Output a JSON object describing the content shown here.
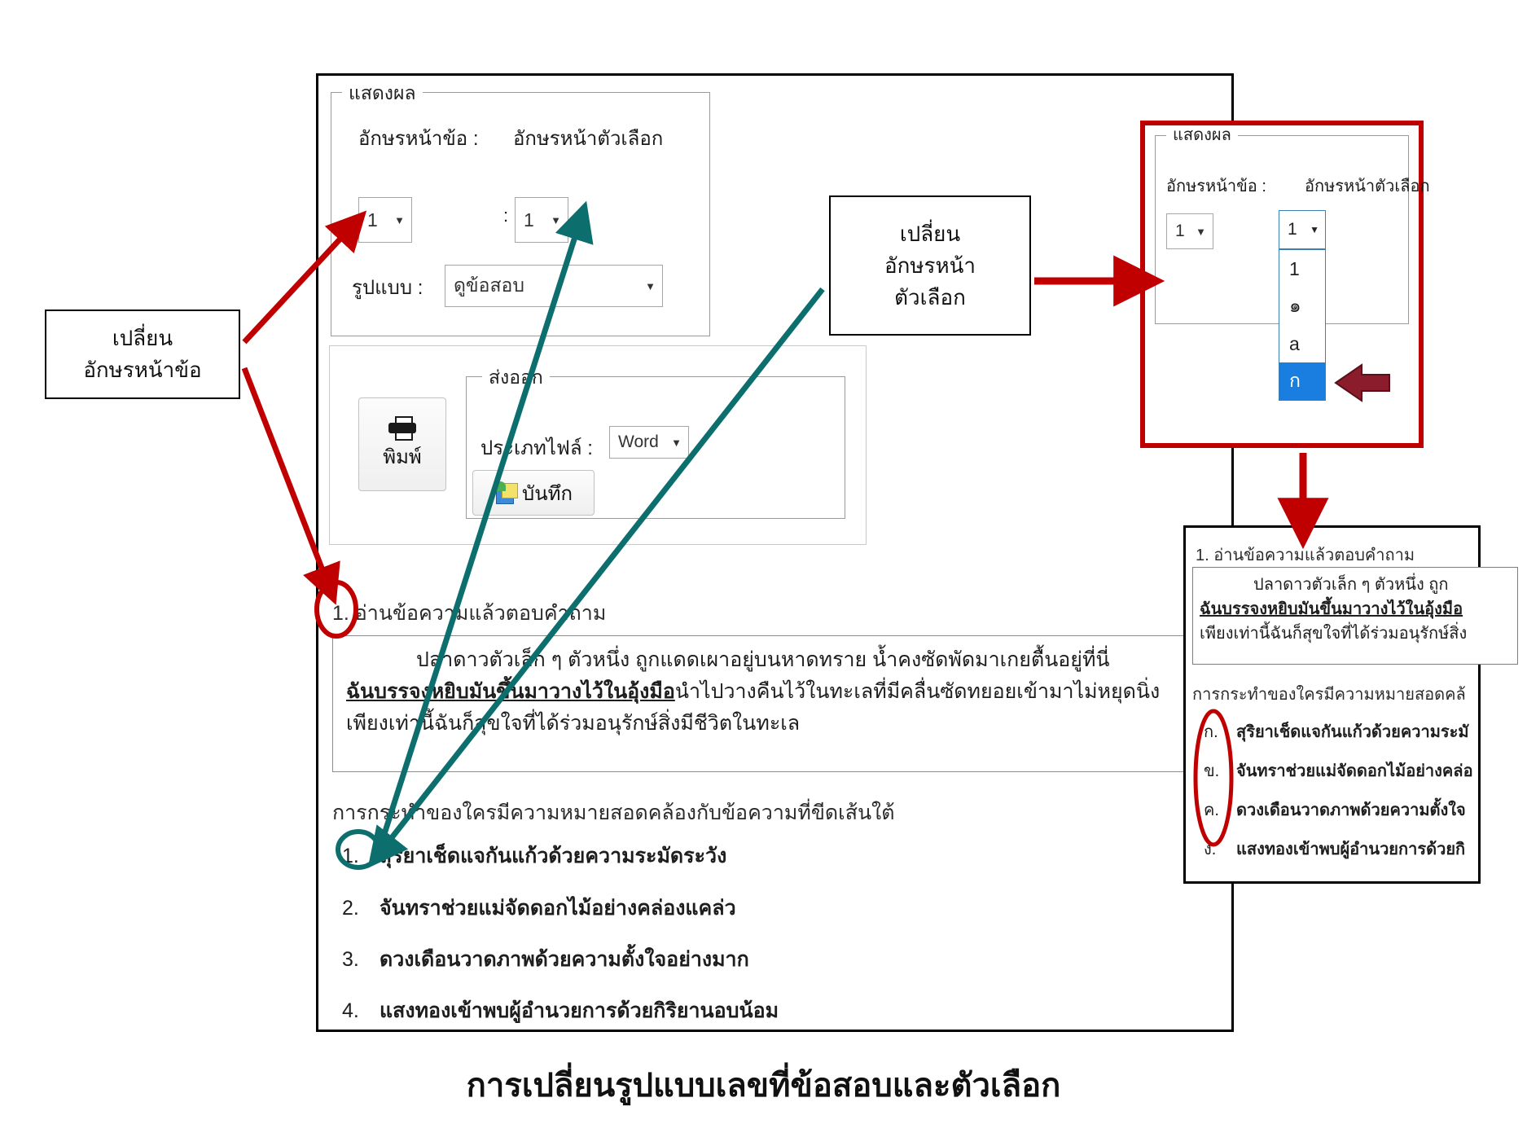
{
  "caption": "การเปลี่ยนรูปแบบเลขที่ข้อสอบและตัวเลือก",
  "colors": {
    "annotation_red": "#c00000",
    "annotation_teal": "#0d6e6e",
    "selection_blue": "#1a7ee0",
    "frame_black": "#000000"
  },
  "display_panel": {
    "legend": "แสดงผล",
    "label_question_prefix": "อักษรหน้าข้อ :",
    "label_choice_prefix": "อักษรหน้าตัวเลือก",
    "question_prefix_value": "1",
    "separator": ":",
    "choice_prefix_value": "1",
    "format_label": "รูปแบบ :",
    "format_value": "ดูข้อสอบ",
    "caret": "▼"
  },
  "export_panel": {
    "legend": "ส่งออก",
    "print_button_label": "พิมพ์",
    "print_icon": "printer-icon",
    "filetype_label": "ประเภทไฟล์ :",
    "filetype_value": "Word",
    "save_button_label": "บันทึก",
    "save_icon": "save-icon",
    "caret": "▼"
  },
  "content": {
    "question_title": "1. อ่านข้อความแล้วตอบคำถาม",
    "passage_lines": [
      "ปลาดาวตัวเล็ก ๆ ตัวหนึ่ง ถูกแดดเผาอยู่บนหาดทราย น้ำคงซัดพัดมาเกยตื้นอยู่ที่นี่",
      "ฉันบรรจงหยิบมันขึ้นมาวางไว้ในอุ้งมือ|นำไปวางคืนไว้ในทะเลที่มีคลื่นซัดทยอยเข้ามาไม่หยุดนิ่ง",
      "เพียงเท่านี้ฉันก็สุขใจที่ได้ร่วมอนุรักษ์สิ่งมีชีวิตในทะเล"
    ],
    "underlined_segment": "ฉันบรรจงหยิบมันขึ้นมาวางไว้ในอุ้งมือ",
    "question_stem": "การกระทำของใครมีความหมายสอดคล้องกับข้อความที่ขีดเส้นใต้",
    "choices": [
      {
        "num": "1.",
        "text": "สุริยาเช็ดแจกันแก้วด้วยความระมัดระวัง"
      },
      {
        "num": "2.",
        "text": "จันทราช่วยแม่จัดดอกไม้อย่างคล่องแคล่ว"
      },
      {
        "num": "3.",
        "text": "ดวงเดือนวาดภาพด้วยความตั้งใจอย่างมาก"
      },
      {
        "num": "4.",
        "text": "แสงทองเข้าพบผู้อำนวยการด้วยกิริยานอบน้อม"
      }
    ]
  },
  "callouts": {
    "left": {
      "line1": "เปลี่ยน",
      "line2": "อักษรหน้าข้อ"
    },
    "middle": {
      "line1": "เปลี่ยน",
      "line2": "อักษรหน้า",
      "line3": "ตัวเลือก"
    }
  },
  "right_top": {
    "legend": "แสดงผล",
    "label_question_prefix": "อักษรหน้าข้อ :",
    "label_choice_prefix": "อักษรหน้าตัวเลือก",
    "question_prefix_value": "1",
    "choice_prefix_value": "1",
    "caret": "▼",
    "dropdown_options": [
      "1",
      "๑",
      "a",
      "ก"
    ],
    "dropdown_selected": "ก",
    "pointer_icon": "left-arrow-icon"
  },
  "right_bottom": {
    "question_title": "1. อ่านข้อความแล้วตอบคำถาม",
    "passage_lines": [
      "ปลาดาวตัวเล็ก ๆ ตัวหนึ่ง ถูก",
      "ฉันบรรจงหยิบมันขึ้นมาวางไว้ในอุ้งมือ",
      "เพียงเท่านี้ฉันก็สุขใจที่ได้ร่วมอนุรักษ์สิ่ง"
    ],
    "question_stem": "การกระทำของใครมีความหมายสอดคล้",
    "choices": [
      {
        "num": "ก.",
        "text": "สุริยาเช็ดแจกันแก้วด้วยความระมั"
      },
      {
        "num": "ข.",
        "text": "จันทราช่วยแม่จัดดอกไม้อย่างคล่อ"
      },
      {
        "num": "ค.",
        "text": "ดวงเดือนวาดภาพด้วยความตั้งใจ"
      },
      {
        "num": "ง.",
        "text": "แสงทองเข้าพบผู้อำนวยการด้วยกิ"
      }
    ]
  }
}
